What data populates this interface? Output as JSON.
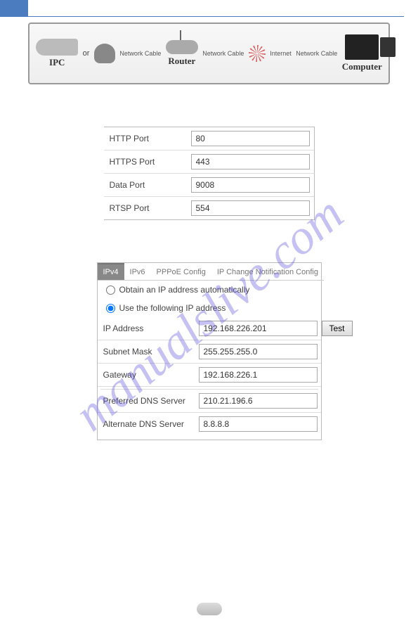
{
  "watermark": "manualslive.com",
  "diagram": {
    "ipc_label": "IPC",
    "or": "or",
    "router_label": "Router",
    "computer_label": "Computer",
    "cable1": "Network Cable",
    "cable2": "Network Cable",
    "cable3": "Network Cable",
    "internet_label": "Internet"
  },
  "ports": {
    "http_label": "HTTP Port",
    "http_value": "80",
    "https_label": "HTTPS Port",
    "https_value": "443",
    "data_label": "Data Port",
    "data_value": "9008",
    "rtsp_label": "RTSP Port",
    "rtsp_value": "554"
  },
  "ip": {
    "tabs": {
      "ipv4": "IPv4",
      "ipv6": "IPv6",
      "pppoe": "PPPoE Config",
      "ipchange": "IP Change Notification Config"
    },
    "radio_auto": "Obtain an IP address automatically",
    "radio_static": "Use the following IP address",
    "ip_label": "IP Address",
    "ip_value": "192.168.226.201",
    "test_button": "Test",
    "subnet_label": "Subnet Mask",
    "subnet_value": "255.255.255.0",
    "gateway_label": "Gateway",
    "gateway_value": "192.168.226.1",
    "pref_dns_label": "Preferred DNS Server",
    "pref_dns_value": "210.21.196.6",
    "alt_dns_label": "Alternate DNS Server",
    "alt_dns_value": "8.8.8.8"
  }
}
